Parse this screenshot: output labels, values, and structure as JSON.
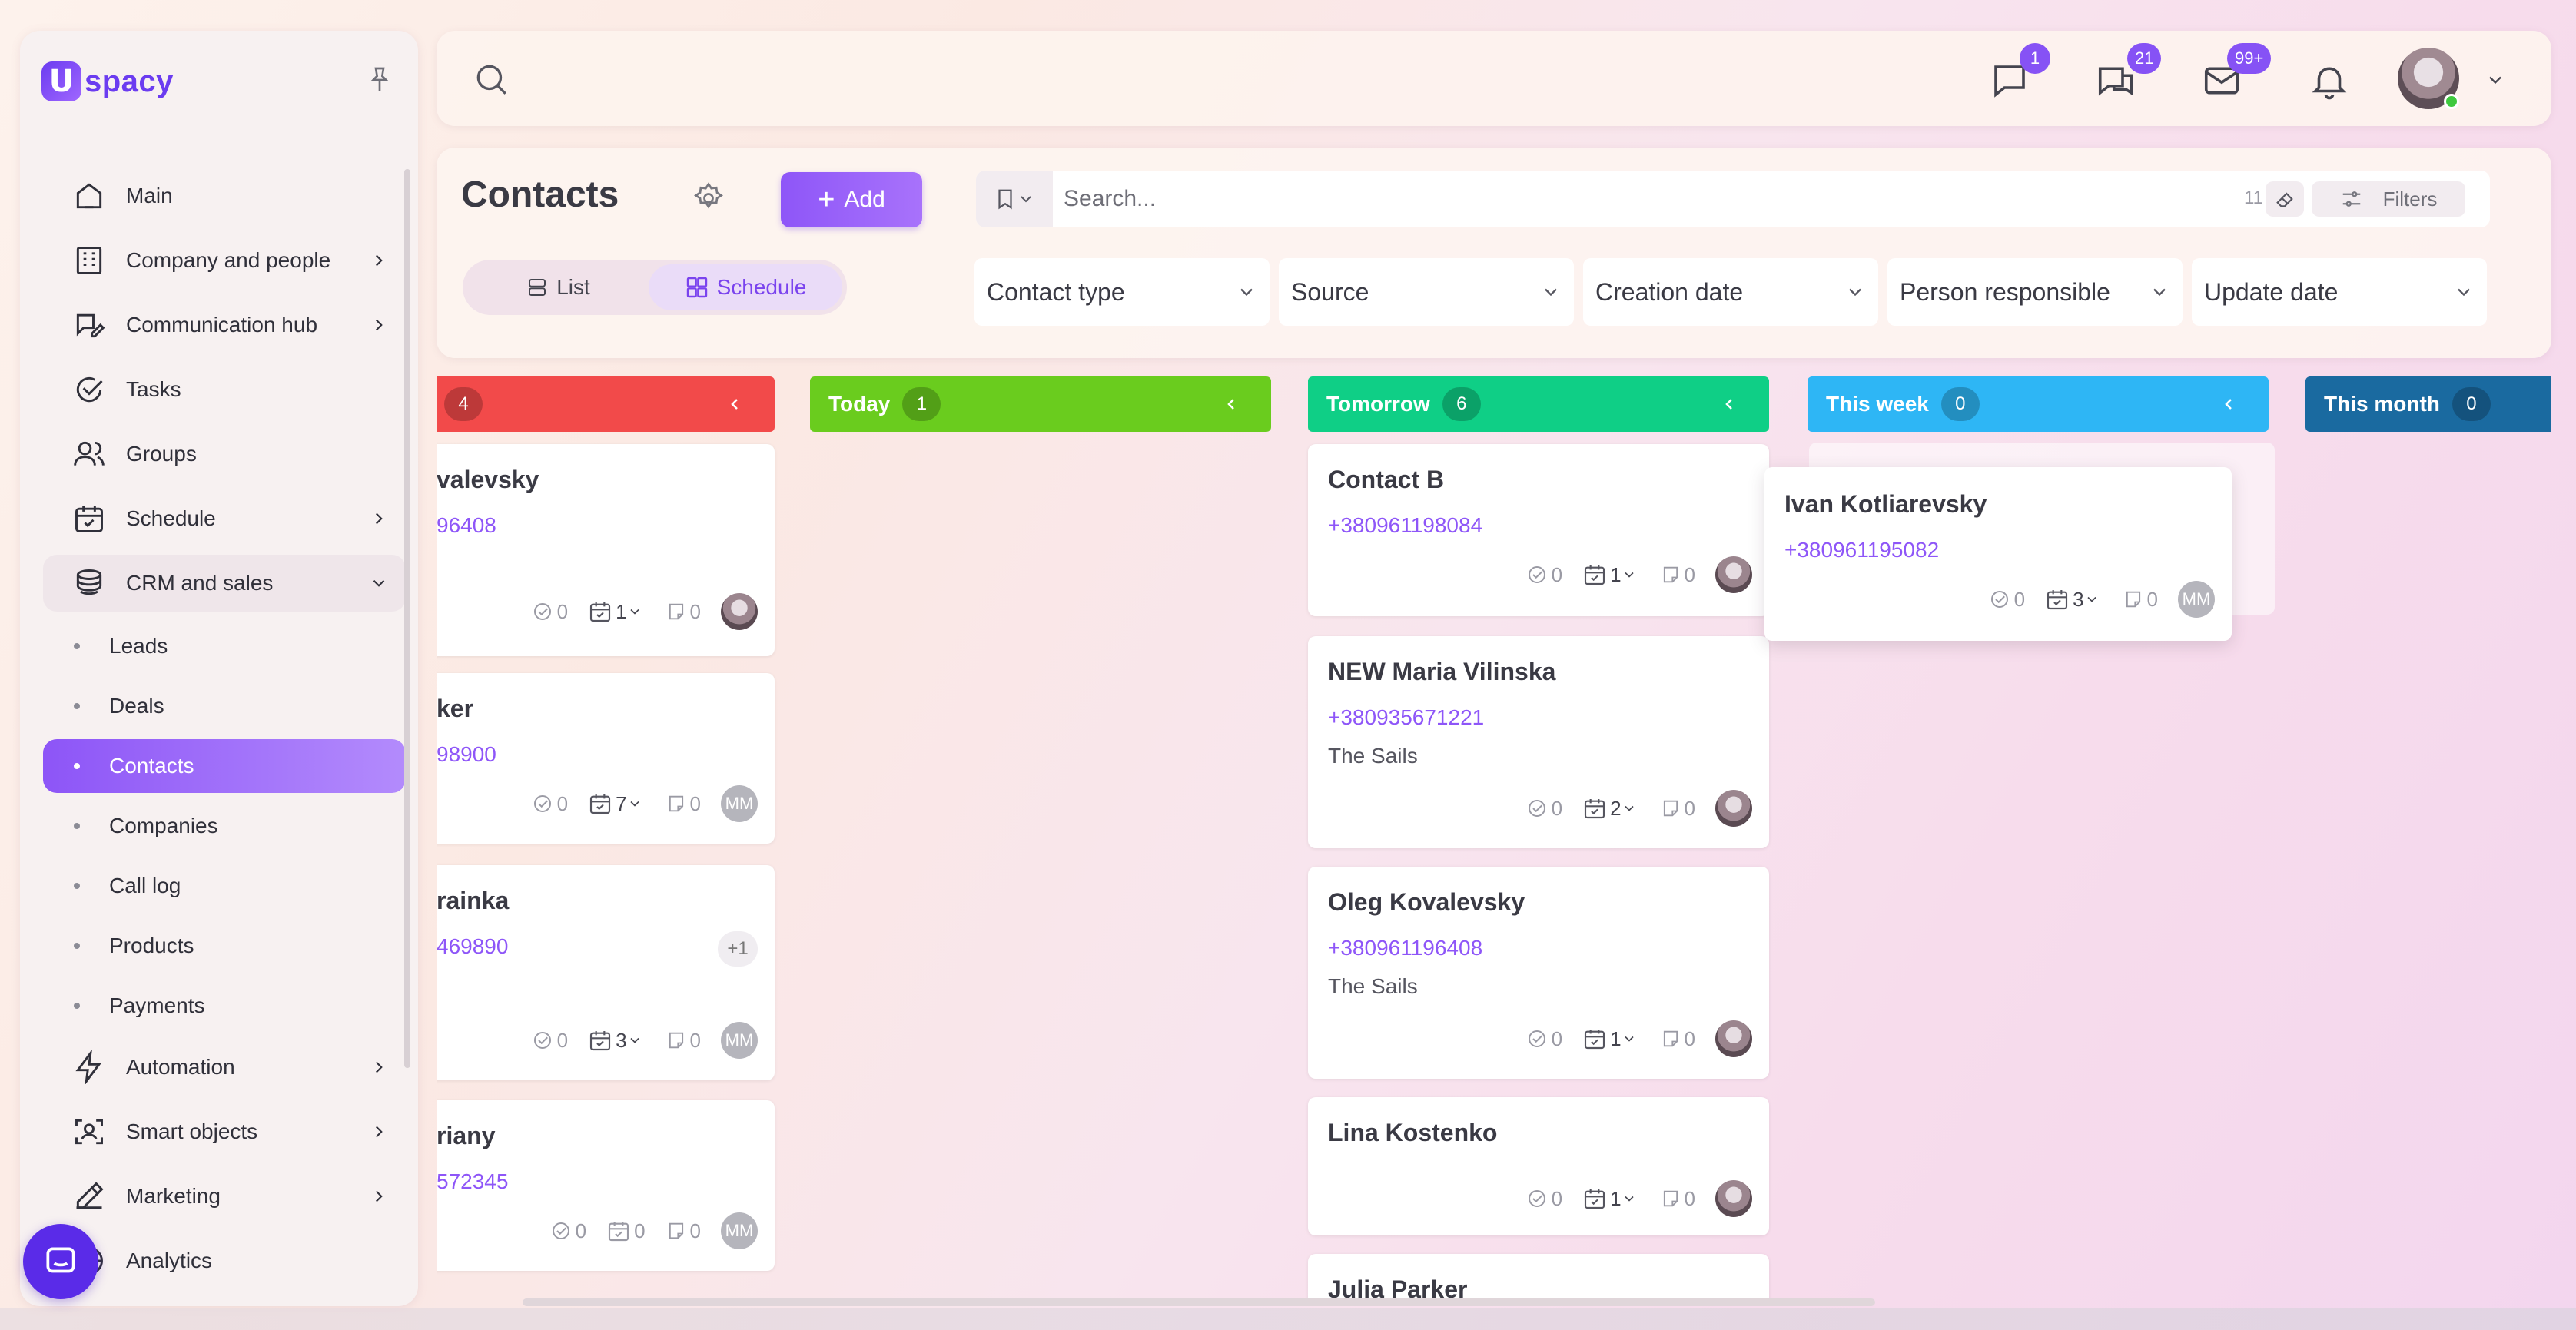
{
  "brand": {
    "logo_letter": "U",
    "logo_text": "spacy"
  },
  "sidebar": {
    "items": [
      {
        "label": "Main",
        "icon": "home-icon"
      },
      {
        "label": "Company and people",
        "icon": "building-icon"
      },
      {
        "label": "Communication hub",
        "icon": "chat-edit-icon"
      },
      {
        "label": "Tasks",
        "icon": "check-circle-icon"
      },
      {
        "label": "Groups",
        "icon": "users-icon"
      },
      {
        "label": "Schedule",
        "icon": "calendar-icon"
      },
      {
        "label": "CRM and sales",
        "icon": "coins-icon"
      }
    ],
    "crm_sub": [
      "Leads",
      "Deals",
      "Contacts",
      "Companies",
      "Call log",
      "Products",
      "Payments"
    ],
    "items_after": [
      {
        "label": "Automation",
        "icon": "lightning-icon"
      },
      {
        "label": "Smart objects",
        "icon": "scan-icon"
      },
      {
        "label": "Marketing",
        "icon": "megaphone-icon"
      },
      {
        "label": "Analytics",
        "icon": "chart-icon"
      }
    ]
  },
  "topbar": {
    "badges": {
      "messages": "1",
      "chats": "21",
      "mail": "99+"
    }
  },
  "header": {
    "title": "Contacts",
    "add_label": "Add",
    "view_list": "List",
    "view_schedule": "Schedule",
    "search_placeholder": "Search...",
    "result_count": "11",
    "filters_label": "Filters",
    "dropdowns": [
      "Contact type",
      "Source",
      "Creation date",
      "Person responsible",
      "Update date"
    ]
  },
  "board": {
    "columns": [
      {
        "title": "",
        "count": "4",
        "color": "#f24a4a"
      },
      {
        "title": "Today",
        "count": "1",
        "color": "#6acc1e"
      },
      {
        "title": "Tomorrow",
        "count": "6",
        "color": "#0fcf86"
      },
      {
        "title": "This week",
        "count": "0",
        "color": "#2eb6f5"
      },
      {
        "title": "This month",
        "count": "0",
        "color": "#1a6aa0"
      }
    ],
    "overdue_cards": [
      {
        "name": "valevsky",
        "phone": "96408",
        "tasks": "0",
        "events": "1",
        "notes": "0"
      },
      {
        "name": "ker",
        "phone": "98900",
        "tasks": "0",
        "events": "7",
        "notes": "0",
        "avatar": "MM"
      },
      {
        "name": "rainka",
        "phone": "469890",
        "tasks": "0",
        "events": "3",
        "notes": "0",
        "avatar": "MM",
        "extra": "+1"
      },
      {
        "name": "riany",
        "phone": "572345",
        "tasks": "0",
        "events": "0",
        "notes": "0",
        "avatar": "MM"
      }
    ],
    "tomorrow_cards": [
      {
        "name": "Contact B",
        "phone": "+380961198084",
        "tasks": "0",
        "events": "1",
        "notes": "0"
      },
      {
        "name": "NEW Maria Vilinska",
        "phone": "+380935671221",
        "company": "The Sails",
        "tasks": "0",
        "events": "2",
        "notes": "0"
      },
      {
        "name": "Oleg Kovalevsky",
        "phone": "+380961196408",
        "company": "The Sails",
        "tasks": "0",
        "events": "1",
        "notes": "0"
      },
      {
        "name": "Lina Kostenko",
        "tasks": "0",
        "events": "1",
        "notes": "0"
      },
      {
        "name": "Julia Parker"
      }
    ],
    "dragged_card": {
      "name": "Ivan Kotliarevsky",
      "phone": "+380961195082",
      "tasks": "0",
      "events": "3",
      "notes": "0",
      "avatar": "MM"
    }
  }
}
